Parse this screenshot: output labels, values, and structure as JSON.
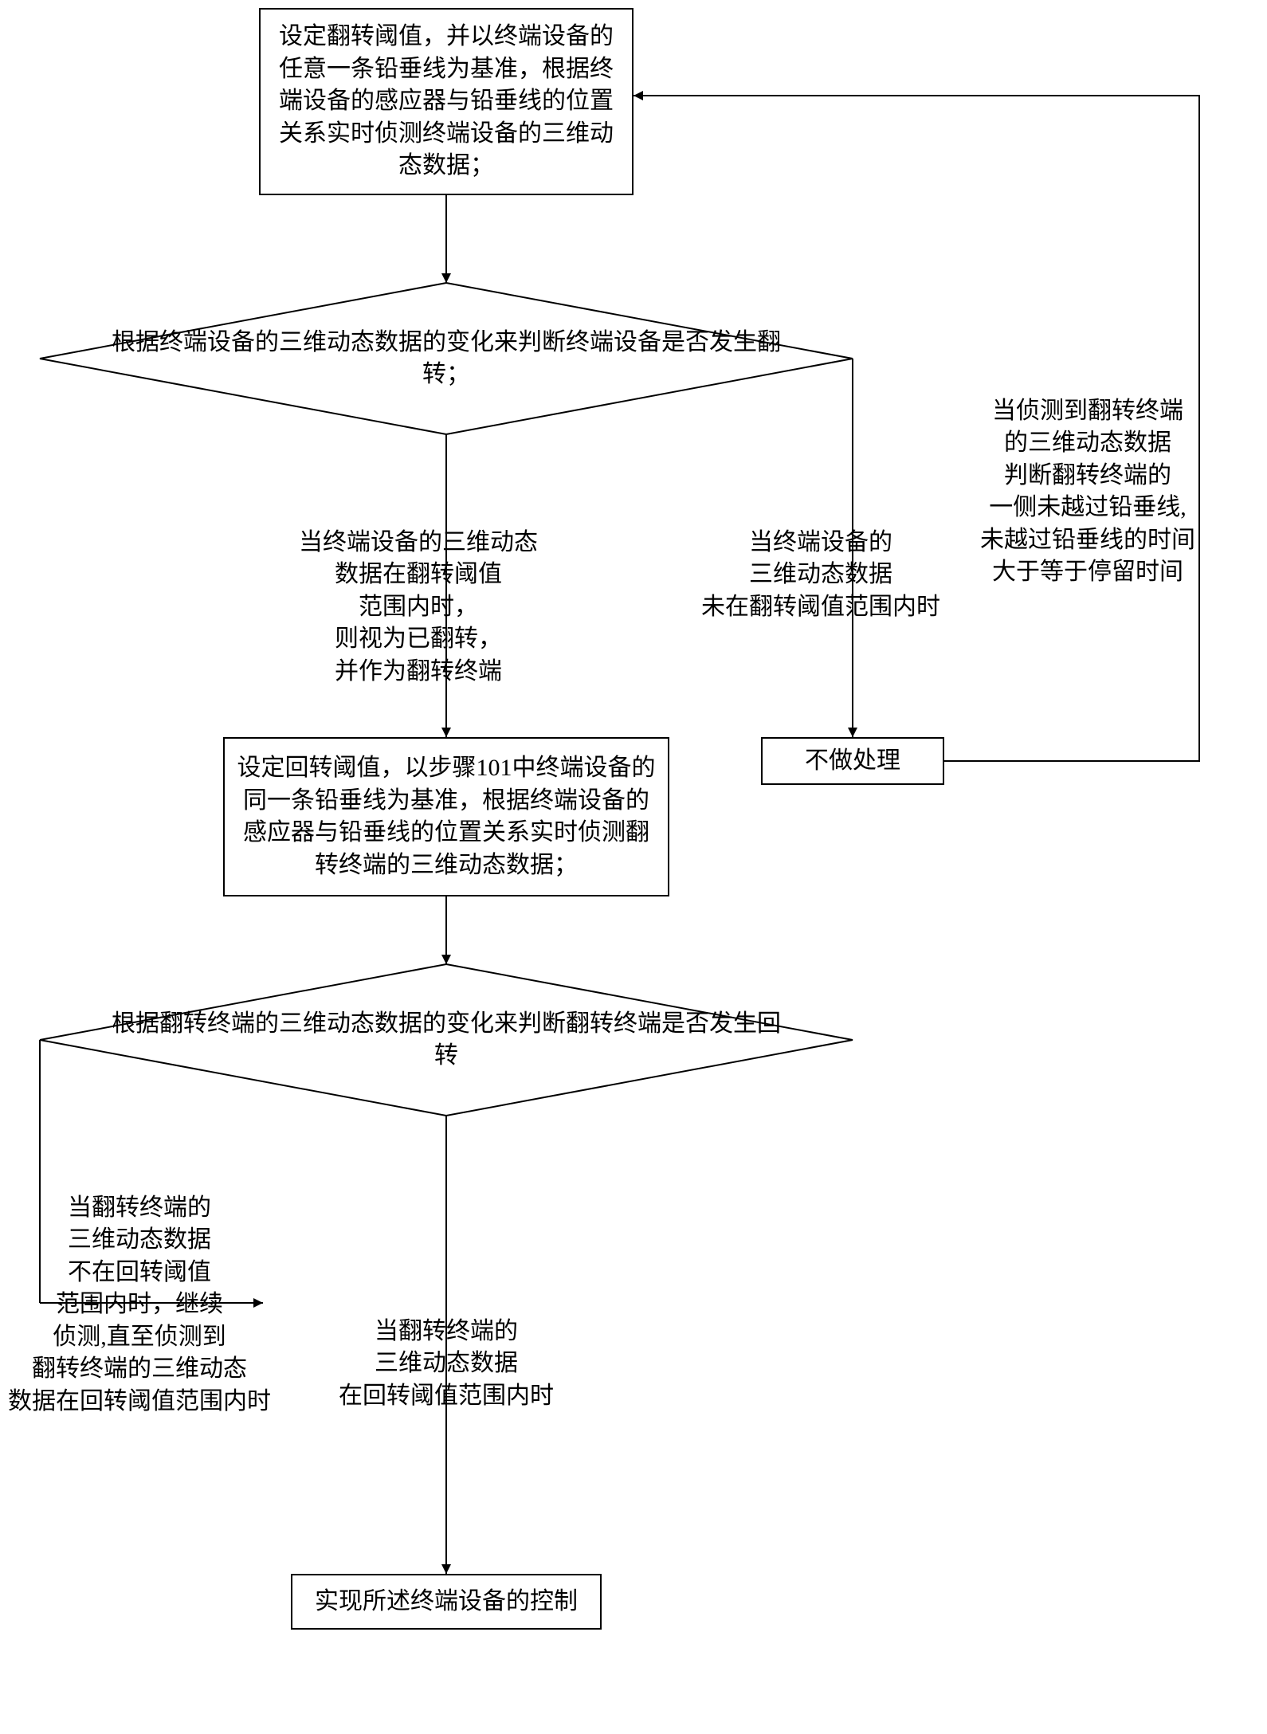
{
  "chart_data": {
    "type": "flowchart",
    "nodes": [
      {
        "id": "n1",
        "shape": "rect",
        "text": "设定翻转阈值，并以终端设备的任意一条铅垂线为基准，根据终端设备的感应器与铅垂线的位置关系实时侦测终端设备的三维动态数据；"
      },
      {
        "id": "d1",
        "shape": "diamond",
        "text": "根据终端设备的三维动态数据的变化来判断终端设备是否发生翻转；"
      },
      {
        "id": "n2",
        "shape": "rect",
        "text": "设定回转阈值，以步骤101中终端设备的同一条铅垂线为基准，根据终端设备的感应器与铅垂线的位置关系实时侦测翻转终端的三维动态数据；"
      },
      {
        "id": "d2",
        "shape": "diamond",
        "text": "根据翻转终端的三维动态数据的变化来判断翻转终端是否发生回转"
      },
      {
        "id": "n3",
        "shape": "rect",
        "text": "不做处理"
      },
      {
        "id": "n4",
        "shape": "rect",
        "text": "实现所述终端设备的控制"
      }
    ],
    "edges": [
      {
        "from": "n1",
        "to": "d1",
        "label": ""
      },
      {
        "from": "d1",
        "to": "n2",
        "label": "当终端设备的三维动态数据在翻转阈值范围内时，则视为已翻转，并作为翻转终端"
      },
      {
        "from": "d1",
        "to": "n3",
        "label": "当终端设备的三维动态数据未在翻转阈值范围内时"
      },
      {
        "from": "n2",
        "to": "d2",
        "label": ""
      },
      {
        "from": "d2",
        "to": "d2",
        "label": "当翻转终端的三维动态数据不在回转阈值范围内时，继续侦测,直至侦测到翻转终端的三维动态数据数据在回转阈值范围内时"
      },
      {
        "from": "d2",
        "to": "n4",
        "label": "当翻转终端的三维动态数据在回转阈值范围内时"
      },
      {
        "from": "n3",
        "to": "n1",
        "label": "当侦测到翻转终端的三维动态数据判断翻转终端的一侧未越过铅垂线,未越过铅垂线的时间大于等于停留时间"
      }
    ]
  },
  "nodes": {
    "n1": "设定翻转阈值，并以终端设备的任意一条铅垂线为基准，根据终端设备的感应器与铅垂线的位置关系实时侦测终端设备的三维动态数据；",
    "d1": "根据终端设备的三维动态数据的变化来判断终端设备是否发生翻转；",
    "n2": "设定回转阈值，以步骤101中终端设备的同一条铅垂线为基准，根据终端设备的感应器与铅垂线的位置关系实时侦测翻转终端的三维动态数据；",
    "d2": "根据翻转终端的三维动态数据的变化来判断翻转终端是否发生回转",
    "n3": "不做处理",
    "n4": "实现所述终端设备的控制"
  },
  "labels": {
    "l_yes_flip": "当终端设备的三维动态\n数据在翻转阈值\n范围内时，\n则视为已翻转，\n并作为翻转终端",
    "l_no_flip": "当终端设备的\n三维动态数据\n未在翻转阈值范围内时",
    "l_feedback_right": "当侦测到翻转终端\n的三维动态数据\n判断翻转终端的\n一侧未越过铅垂线,\n未越过铅垂线的时间\n大于等于停留时间",
    "l_not_in_return": "当翻转终端的\n三维动态数据\n不在回转阈值\n范围内时，继续\n侦测,直至侦测到\n翻转终端的三维动态\n数据在回转阈值范围内时",
    "l_in_return": "当翻转终端的\n三维动态数据\n在回转阈值范围内时"
  }
}
